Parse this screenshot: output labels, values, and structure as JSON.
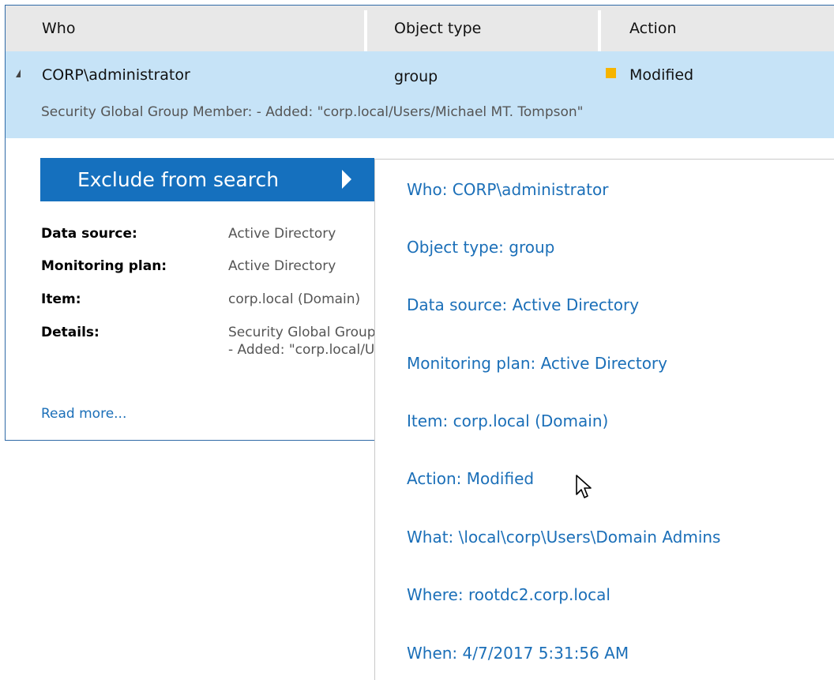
{
  "table": {
    "columns": [
      "Who",
      "Object type",
      "Action"
    ],
    "selected_row": {
      "who": "CORP\\administrator",
      "object_type": "group",
      "action": "Modified",
      "action_color": "#f6b400",
      "detail": "Security Global Group Member: - Added: \"corp.local/Users/Michael MT. Tompson\""
    }
  },
  "details_panel": {
    "exclude_button": "Exclude from search",
    "rows": [
      {
        "label": "Data source:",
        "value": "Active Directory"
      },
      {
        "label": "Monitoring plan:",
        "value": "Active Directory"
      },
      {
        "label": "Item:",
        "value": "corp.local (Domain)"
      },
      {
        "label": "Details:",
        "value": "Security Global Group Member:",
        "value2": "- Added: \"corp.local/Users/Michael MT. Tompson\""
      }
    ],
    "read_more": "Read more..."
  },
  "exclude_menu": {
    "items": [
      "Who: CORP\\administrator",
      "Object type: group",
      "Data source: Active Directory",
      "Monitoring plan: Active Directory",
      "Item: corp.local (Domain)",
      "Action: Modified",
      "What: \\local\\corp\\Users\\Domain Admins",
      "Where: rootdc2.corp.local",
      "When: 4/7/2017 5:31:56 AM"
    ]
  },
  "colors": {
    "accent": "#1570be",
    "selection": "#c6e3f7",
    "link": "#1b6fb8"
  }
}
